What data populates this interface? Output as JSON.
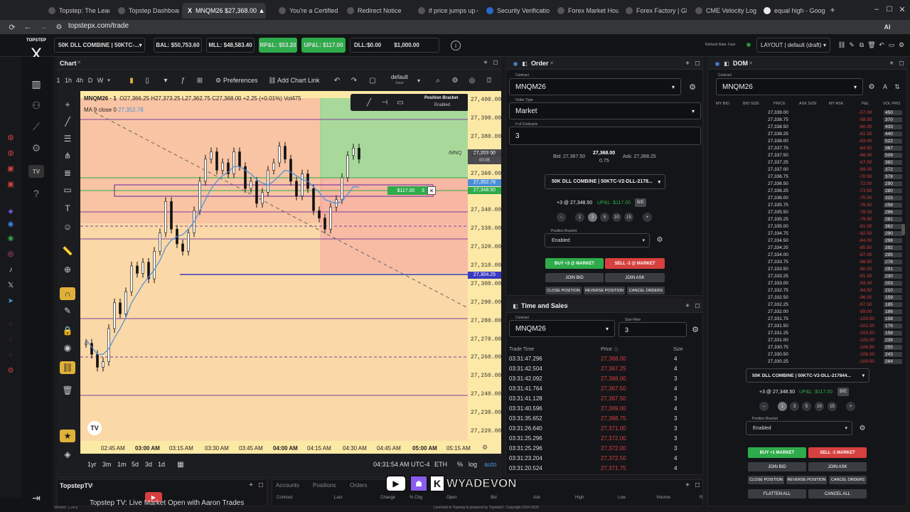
{
  "browser": {
    "tabs": [
      {
        "label": "Topstep: The Leadi"
      },
      {
        "label": "Topstep Dashboard"
      },
      {
        "label": "MNQM26 $27,368.00 ▲"
      },
      {
        "label": "You're a Certified"
      },
      {
        "label": "Redirect Notice"
      },
      {
        "label": "if price jumps up ov"
      },
      {
        "label": "Security Verificatio"
      },
      {
        "label": "Forex Market Hours"
      },
      {
        "label": "Forex Factory | Glo"
      },
      {
        "label": "CME Velocity Logic"
      },
      {
        "label": "equal high - Google"
      }
    ],
    "url": "topstepx.com/trade"
  },
  "header": {
    "logo": "TOPSTEP",
    "account": "50K DLL COMBINE | 50KTC-...",
    "bal": "BAL: $50,753.60",
    "mll": "MLL: $48,583.40",
    "rpl": "RP&L: $53.20",
    "upl": "UP&L: $117.00",
    "dll": "DLL:$0.00",
    "dll_limit": "$1,000.00",
    "refresh": "Refresh Rate: Fast",
    "layout": "LAYOUT | default (draft)"
  },
  "chart": {
    "panel_title": "Chart",
    "intervals": [
      "1h",
      "4h",
      "D",
      "W"
    ],
    "preferences": "Preferences",
    "add_chart_link": "Add Chart Link",
    "layout_name": "default",
    "layout_save": "Save",
    "symbol": "MNQM26 · 1",
    "ohlc": "O27,366.25  H27,373.25  L27,362.75  C27,368.00  +2.25 (+0.01%)  Vol475",
    "ma": "MA 9 close 0",
    "ma_value": "27,352.78",
    "position_bracket": "Position Bracket",
    "position_bracket_state": "Enabled",
    "mnq_tag": "/MNQ",
    "price_tag": "27,368.00",
    "countdown": "00:05",
    "ma_tag": "27,352.78",
    "pos_tag": "27,348.50",
    "stop_tag": "27,304.25",
    "pnl_tag": "$117.00",
    "pnl_qty": "3",
    "y_ticks": [
      "27,400.00",
      "27,390.00",
      "27,380.00",
      "27,370.00",
      "27,360.00",
      "27,340.00",
      "27,330.00",
      "27,320.00",
      "27,310.00",
      "27,300.00",
      "27,290.00",
      "27,280.00",
      "27,270.00",
      "27,260.00",
      "27,250.00",
      "27,240.00",
      "27,230.00",
      "27,220.00"
    ],
    "x_ticks": [
      "02:45 AM",
      "03:00 AM",
      "03:15 AM",
      "03:30 AM",
      "03:45 AM",
      "04:00 AM",
      "04:15 AM",
      "04:30 AM",
      "04:45 AM",
      "05:00 AM",
      "05:15 AM"
    ],
    "ranges": [
      "1yr",
      "3m",
      "1m",
      "5d",
      "3d",
      "1d"
    ],
    "clock": "04:31:54 AM UTC-4",
    "session": "ETH",
    "scale_pct": "%",
    "scale_log": "log",
    "scale_auto": "auto"
  },
  "chart_data": {
    "type": "line",
    "title": "",
    "xlabel": "",
    "ylabel": "",
    "ylim": [
      27220,
      27400
    ],
    "series": [
      {
        "name": "MNQM26",
        "values": [
          27268,
          27262,
          27255,
          27258,
          27276,
          27290,
          27284,
          27296,
          27310,
          27306,
          27312,
          27303,
          27318,
          27328,
          27345,
          27330,
          27322,
          27318,
          27328,
          27340,
          27356,
          27368,
          27372,
          27362,
          27366,
          27360,
          27372,
          27364,
          27352,
          27356,
          27344,
          27350,
          27362,
          27366,
          27375,
          27368,
          27356,
          27348,
          27360,
          27352,
          27340,
          27336,
          27330,
          27342,
          27346,
          27358,
          27370,
          27374,
          27368
        ]
      },
      {
        "name": "MA 9 close 0",
        "values": [
          27270,
          27266,
          27262,
          27262,
          27265,
          27271,
          27276,
          27282,
          27290,
          27295,
          27300,
          27304,
          27308,
          27313,
          27320,
          27324,
          27326,
          27327,
          27330,
          27334,
          27340,
          27346,
          27352,
          27356,
          27359,
          27361,
          27364,
          27364,
          27362,
          27360,
          27357,
          27355,
          27354,
          27356,
          27359,
          27362,
          27361,
          27359,
          27357,
          27356,
          27353,
          27350,
          27346,
          27345,
          27344,
          27345,
          27349,
          27353,
          27352.78
        ]
      }
    ]
  },
  "order": {
    "title": "Order",
    "contract_label": "Contract",
    "contract": "MNQM26",
    "type_label": "Order Type",
    "type": "Market",
    "qty_label": "# of Contracts",
    "qty": "3",
    "bid": "Bid: 27,367.50",
    "last": "27,368.00",
    "spread": "0.75",
    "ask": "Ask: 27,368.25",
    "account": "50K DLL COMBINE | 50KTC-V2-DLL-2178...",
    "position": "+3 @ 27,348.50",
    "upl": "UP&L: $117.00",
    "be": "B/E",
    "qty_buttons": [
      "1",
      "3",
      "5",
      "10",
      "15"
    ],
    "bracket_label": "Position Bracket",
    "bracket": "Enabled",
    "buy": "BUY +3 @ MARKET",
    "sell": "SELL -3 @ MARKET",
    "join_bid": "JOIN BID",
    "join_ask": "JOIN ASK",
    "close_position": "CLOSE POSITION",
    "reverse_position": "REVERSE POSITION",
    "cancel_orders": "CANCEL ORDERS"
  },
  "tas": {
    "title": "Time and Sales",
    "contract_label": "Contract",
    "contract": "MNQM26",
    "size_label": "Size Filter",
    "size": "3",
    "headers": [
      "Trade Time",
      "Price",
      "Size"
    ],
    "rows": [
      {
        "time": "03:31:47.296",
        "price": "27,368.00",
        "size": "4"
      },
      {
        "time": "03:31:42.504",
        "price": "27,367.25",
        "size": "4"
      },
      {
        "time": "03:31:42.092",
        "price": "27,368.00",
        "size": "3"
      },
      {
        "time": "03:31:41.764",
        "price": "27,367.50",
        "size": "4"
      },
      {
        "time": "03:31:41.128",
        "price": "27,367.50",
        "size": "3"
      },
      {
        "time": "03:31:40.596",
        "price": "27,369.00",
        "size": "4"
      },
      {
        "time": "03:31:35.652",
        "price": "27,368.75",
        "size": "3"
      },
      {
        "time": "03:31:26.640",
        "price": "27,371.00",
        "size": "3"
      },
      {
        "time": "03:31:25.296",
        "price": "27,372.00",
        "size": "3"
      },
      {
        "time": "03:31:25.296",
        "price": "27,372.00",
        "size": "3"
      },
      {
        "time": "03:31:23.204",
        "price": "27,372.50",
        "size": "4"
      },
      {
        "time": "03:31:20.524",
        "price": "27,371.75",
        "size": "4"
      }
    ]
  },
  "dom": {
    "title": "DOM",
    "contract_label": "Contract",
    "contract": "MNQM26",
    "headers": [
      "MY BID",
      "BID SIZE",
      "PRICE",
      "ASK SIZE",
      "MY ASK",
      "P&L",
      "VOL PRO."
    ],
    "rows": [
      {
        "price": "27,339.00",
        "pnl": "-57.00",
        "vol": "450"
      },
      {
        "price": "27,338.75",
        "pnl": "-58.50",
        "vol": "370"
      },
      {
        "price": "27,338.50",
        "pnl": "-60.00",
        "vol": "433"
      },
      {
        "price": "27,338.25",
        "pnl": "-61.50",
        "vol": "440"
      },
      {
        "price": "27,338.00",
        "pnl": "-63.00",
        "vol": "522"
      },
      {
        "price": "27,337.75",
        "pnl": "-64.50",
        "vol": "367"
      },
      {
        "price": "27,337.50",
        "pnl": "-66.00",
        "vol": "509"
      },
      {
        "price": "27,337.25",
        "pnl": "-67.50",
        "vol": "382"
      },
      {
        "price": "27,337.00",
        "pnl": "-69.00",
        "vol": "372"
      },
      {
        "price": "27,336.75",
        "pnl": "-70.50",
        "vol": "378"
      },
      {
        "price": "27,336.50",
        "pnl": "-72.00",
        "vol": "290"
      },
      {
        "price": "27,336.25",
        "pnl": "-73.50",
        "vol": "280"
      },
      {
        "price": "27,336.00",
        "pnl": "-75.00",
        "vol": "315"
      },
      {
        "price": "27,335.75",
        "pnl": "-76.50",
        "vol": "258"
      },
      {
        "price": "27,335.50",
        "pnl": "-78.00",
        "vol": "296"
      },
      {
        "price": "27,335.25",
        "pnl": "-79.50",
        "vol": "281"
      },
      {
        "price": "27,335.00",
        "pnl": "-81.00",
        "vol": "362"
      },
      {
        "price": "27,334.75",
        "pnl": "-82.50",
        "vol": "290"
      },
      {
        "price": "27,334.50",
        "pnl": "-84.00",
        "vol": "298"
      },
      {
        "price": "27,334.25",
        "pnl": "-85.50",
        "vol": "292"
      },
      {
        "price": "27,334.00",
        "pnl": "-87.00",
        "vol": "295"
      },
      {
        "price": "27,333.75",
        "pnl": "-88.50",
        "vol": "278"
      },
      {
        "price": "27,333.50",
        "pnl": "-90.00",
        "vol": "291"
      },
      {
        "price": "27,333.25",
        "pnl": "-91.50",
        "vol": "230"
      },
      {
        "price": "27,333.00",
        "pnl": "-93.00",
        "vol": "203"
      },
      {
        "price": "27,332.75",
        "pnl": "-94.50",
        "vol": "210"
      },
      {
        "price": "27,332.50",
        "pnl": "-96.00",
        "vol": "159"
      },
      {
        "price": "27,332.25",
        "pnl": "-97.50",
        "vol": "185"
      },
      {
        "price": "27,332.00",
        "pnl": "-99.00",
        "vol": "186"
      },
      {
        "price": "27,331.75",
        "pnl": "-100.50",
        "vol": "158"
      },
      {
        "price": "27,331.50",
        "pnl": "-102.00",
        "vol": "179"
      },
      {
        "price": "27,331.25",
        "pnl": "-103.50",
        "vol": "158"
      },
      {
        "price": "27,331.00",
        "pnl": "-105.00",
        "vol": "239"
      },
      {
        "price": "27,330.75",
        "pnl": "-106.50",
        "vol": "255"
      },
      {
        "price": "27,330.50",
        "pnl": "-108.00",
        "vol": "243"
      },
      {
        "price": "27,330.25",
        "pnl": "-109.50",
        "vol": "264"
      }
    ],
    "account": "50K DLL COMBINE | 50KTC-V2-DLL-217844...",
    "position": "+3 @ 27,348.50",
    "upl": "UP&L: $117.00",
    "be": "B/E",
    "qty_buttons": [
      "1",
      "3",
      "5",
      "10",
      "15"
    ],
    "bracket_label": "Position Bracket",
    "bracket": "Enabled",
    "buy": "BUY +1 MARKET",
    "sell": "SELL -1 MARKET",
    "join_bid": "JOIN BID",
    "join_ask": "JOIN ASK",
    "close_position": "CLOSE POSITION",
    "reverse_position": "REVERSE POSITION",
    "cancel_orders": "CANCEL ORDERS",
    "flatten_all": "FLATTEN ALL",
    "cancel_all": "CANCEL ALL"
  },
  "bottom": {
    "tv_title": "TopstepTV",
    "tv_text": "Topstep TV: Live Market Open with Aaron Trades",
    "tabs": [
      "Accounts",
      "Positions",
      "Orders"
    ],
    "headers": [
      "Contract",
      "Last",
      "Change",
      "% Chg",
      "Open",
      "Bid",
      "Ask",
      "High",
      "Low",
      "Volume",
      "R"
    ],
    "version": "Version: 1.24.8",
    "license": "Licensed to Topstep & powered by TopstepX. Copyright 2024-2026",
    "watermark": "WYADEVON"
  },
  "colors": {
    "buy": "#2eab4a",
    "sell": "#d6403f",
    "accent": "#3a6fd6",
    "chart_bg": "#fde9a6",
    "candle": "#111111",
    "ma": "#4b8fd8"
  }
}
